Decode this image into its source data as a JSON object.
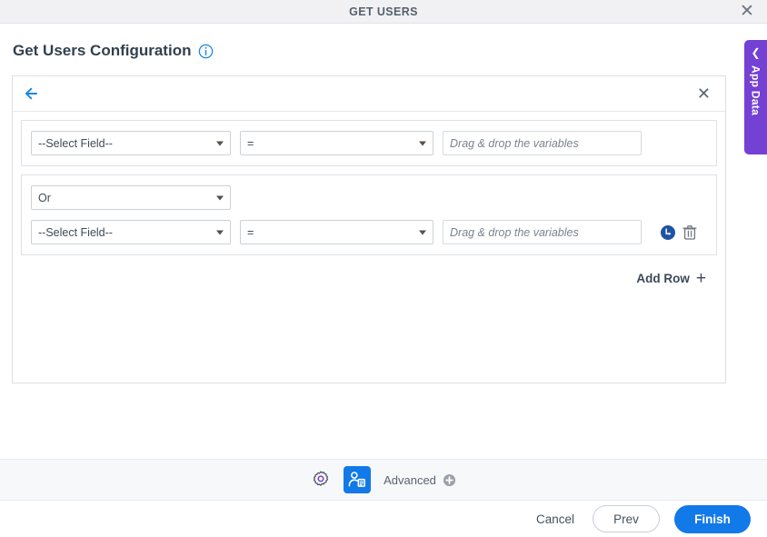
{
  "window": {
    "title": "GET USERS",
    "close_icon": "close-icon"
  },
  "page": {
    "title": "Get Users Configuration",
    "info_icon": "info-circle-icon"
  },
  "panel": {
    "back_icon": "arrow-left-icon",
    "close_icon": "close-icon",
    "groups": [
      {
        "join": null,
        "rows": [
          {
            "field": "--Select Field--",
            "operator": "=",
            "value": "",
            "value_placeholder": "Drag & drop the variables",
            "actions": []
          }
        ]
      },
      {
        "join": "Or",
        "rows": [
          {
            "field": "--Select Field--",
            "operator": "=",
            "value": "",
            "value_placeholder": "Drag & drop the variables",
            "actions": [
              "add-subcondition-icon",
              "delete-icon"
            ]
          }
        ]
      }
    ],
    "add_row_label": "Add Row",
    "add_row_icon": "plus-icon"
  },
  "app_data_tab": {
    "label": "App Data",
    "chevron_icon": "chevron-left-icon",
    "color": "#7540d4"
  },
  "toolbar": {
    "settings_icon": "gear-icon",
    "active_step_icon": "user-card-icon",
    "advanced_label": "Advanced",
    "advanced_icon": "plus-circle-icon",
    "active_color": "#1279e8"
  },
  "footer": {
    "cancel_label": "Cancel",
    "prev_label": "Prev",
    "finish_label": "Finish",
    "primary_color": "#1279e8"
  }
}
